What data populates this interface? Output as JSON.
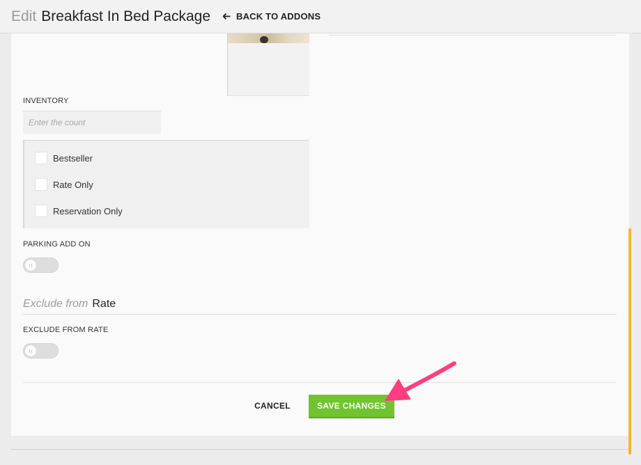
{
  "header": {
    "title_prefix": "Edit",
    "title": "Breakfast In Bed Package",
    "back_label": "BACK TO ADDONS"
  },
  "form": {
    "inventory": {
      "label": "INVENTORY",
      "value": "",
      "placeholder": "Enter the count"
    },
    "flags": [
      {
        "label": "Bestseller",
        "checked": false
      },
      {
        "label": "Rate Only",
        "checked": false
      },
      {
        "label": "Reservation Only",
        "checked": false
      }
    ],
    "parking_add_on": {
      "label": "PARKING ADD ON",
      "enabled": false
    },
    "exclude_section": {
      "heading_muted": "Exclude from",
      "heading_strong": "Rate"
    },
    "exclude_from_rate": {
      "label": "EXCLUDE FROM RATE",
      "enabled": false
    }
  },
  "actions": {
    "cancel_label": "CANCEL",
    "save_label": "SAVE CHANGES"
  },
  "colors": {
    "save_button": "#6fc42f",
    "scrollbar": "#f6b627",
    "annotation_arrow": "#ff3d7f"
  }
}
